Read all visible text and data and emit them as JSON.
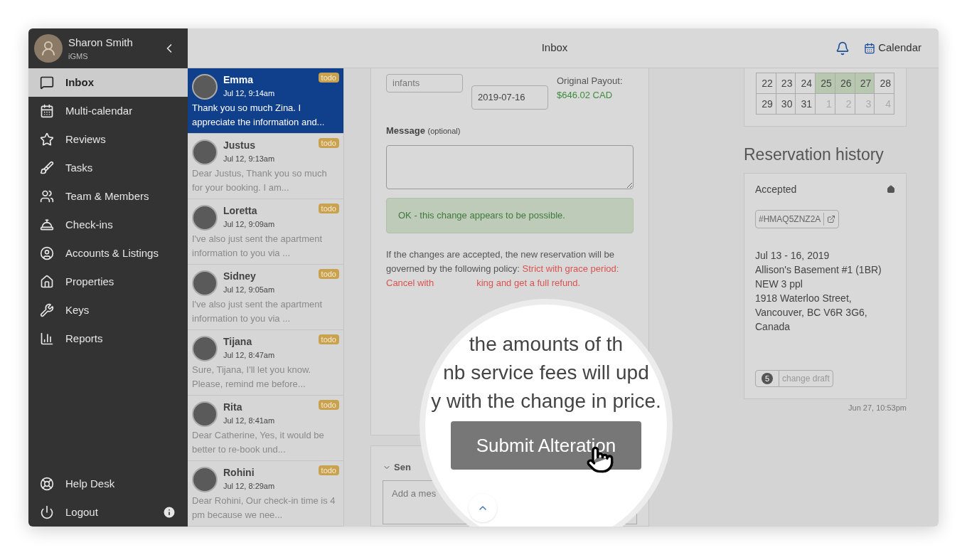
{
  "user": {
    "name": "Sharon Smith",
    "company": "iGMS"
  },
  "nav": [
    {
      "label": "Inbox",
      "selected": true
    },
    {
      "label": "Multi-calendar",
      "selected": false
    },
    {
      "label": "Reviews",
      "selected": false
    },
    {
      "label": "Tasks",
      "selected": false
    },
    {
      "label": "Team & Members",
      "selected": false
    },
    {
      "label": "Check-ins",
      "selected": false
    },
    {
      "label": "Accounts & Listings",
      "selected": false
    },
    {
      "label": "Properties",
      "selected": false
    },
    {
      "label": "Keys",
      "selected": false
    },
    {
      "label": "Reports",
      "selected": false
    }
  ],
  "nav_bottom": [
    {
      "label": "Help Desk"
    },
    {
      "label": "Logout"
    }
  ],
  "header": {
    "title": "Inbox",
    "calendar_link": "Calendar"
  },
  "conversations": [
    {
      "name": "Emma",
      "time": "Jul 12, 9:14am",
      "preview": "Thank you so much Zina. I appreciate the information and...",
      "badge": "todo",
      "selected": true
    },
    {
      "name": "Justus",
      "time": "Jul 12, 9:13am",
      "preview": "Dear Justus, Thank you so much for your booking. I am...",
      "badge": "todo",
      "selected": false
    },
    {
      "name": "Loretta",
      "time": "Jul 12, 9:09am",
      "preview": "I've also just sent the apartment information to you via ...",
      "badge": "todo",
      "selected": false
    },
    {
      "name": "Sidney",
      "time": "Jul 12, 9:05am",
      "preview": "I've also just sent the apartment information to you via ...",
      "badge": "todo",
      "selected": false
    },
    {
      "name": "Tijana",
      "time": "Jul 12, 8:47am",
      "preview": "Sure, Tijana, I'll let you know. Please, remind me before...",
      "badge": "todo",
      "selected": false
    },
    {
      "name": "Rita",
      "time": "Jul 12, 8:41am",
      "preview": "Dear Catherine, Yes, it would be better to re-book und...",
      "badge": "todo",
      "selected": false
    },
    {
      "name": "Rohini",
      "time": "Jul 12, 8:29am",
      "preview": "Dear Rohini, Our check-in time is 4 pm because we nee...",
      "badge": "todo",
      "selected": false
    }
  ],
  "alteration": {
    "infants_value": "infants",
    "date_value": "2019-07-16",
    "payout_label": "Original Payout:",
    "payout_value": "$646.02 CAD",
    "message_label": "Message",
    "message_hint": "(optional)",
    "notice": "OK - this change appears to be possible.",
    "policy_intro": "If the changes are accepted, the new reservation will be governed by the following policy:",
    "policy_start": "Strict with grace period: Cancel with",
    "policy_end": "king and get a full refund."
  },
  "magnifier": {
    "lines": [
      "the amounts of th",
      "nb service fees will upd",
      "y with the change in price."
    ],
    "button": "Submit Alteration"
  },
  "send": {
    "label": "Sen",
    "placeholder": "Add a mes"
  },
  "calendar": {
    "weeks": [
      [
        {
          "day": "22",
          "muted": false,
          "booked": false
        },
        {
          "day": "23",
          "muted": false,
          "booked": false
        },
        {
          "day": "24",
          "muted": false,
          "booked": false
        },
        {
          "day": "25",
          "muted": false,
          "booked": true
        },
        {
          "day": "26",
          "muted": false,
          "booked": true
        },
        {
          "day": "27",
          "muted": false,
          "booked": true
        },
        {
          "day": "28",
          "muted": false,
          "booked": false
        }
      ],
      [
        {
          "day": "29",
          "muted": false,
          "booked": false
        },
        {
          "day": "30",
          "muted": false,
          "booked": false
        },
        {
          "day": "31",
          "muted": false,
          "booked": false
        },
        {
          "day": "1",
          "muted": true,
          "booked": false
        },
        {
          "day": "2",
          "muted": true,
          "booked": false
        },
        {
          "day": "3",
          "muted": true,
          "booked": false
        },
        {
          "day": "4",
          "muted": true,
          "booked": false
        }
      ]
    ]
  },
  "history": {
    "title": "Reservation history",
    "status": "Accepted",
    "code": "#HMAQ5ZNZ2A",
    "details": [
      "Jul 13 - 16, 2019",
      "Allison's Basement #1 (1BR)",
      "NEW 3 ppl",
      "1918 Waterloo Street,",
      "Vancouver, BC V6R 3G6,",
      "Canada"
    ],
    "draft_count": "5",
    "draft_label": "change draft",
    "time": "Jun 27, 10:53pm"
  }
}
